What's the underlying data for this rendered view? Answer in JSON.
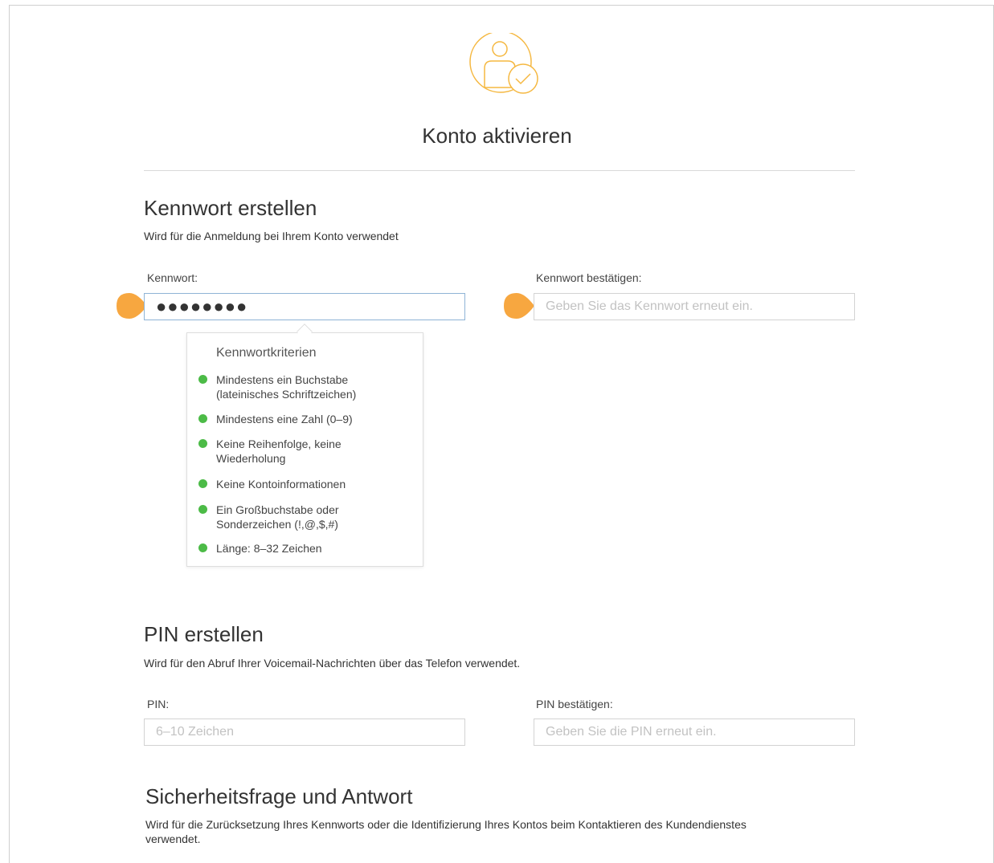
{
  "page": {
    "title": "Konto aktivieren"
  },
  "colors": {
    "accent": "#f7a740",
    "logo": "#f5b841",
    "success": "#4cbb47"
  },
  "icons": {
    "logo": "user-check-icon"
  },
  "password_section": {
    "title": "Kennwort erstellen",
    "description": "Wird für die Anmeldung bei Ihrem Konto verwendet",
    "password_label": "Kennwort:",
    "password_value": "●●●●●●●●",
    "confirm_label": "Kennwort bestätigen:",
    "confirm_placeholder": "Geben Sie das Kennwort erneut ein."
  },
  "criteria": {
    "title": "Kennwortkriterien",
    "items": [
      {
        "line1": "Mindestens ein Buchstabe",
        "line2": "(lateinisches Schriftzeichen)"
      },
      {
        "line1": "Mindestens eine Zahl (0–9)",
        "line2": ""
      },
      {
        "line1": "Keine Reihenfolge, keine",
        "line2": "Wiederholung"
      },
      {
        "line1": "Keine Kontoinformationen",
        "line2": ""
      },
      {
        "line1": "Ein Großbuchstabe oder",
        "line2": "Sonderzeichen (!,@,$,#)"
      },
      {
        "line1": "Länge: 8–32 Zeichen",
        "line2": ""
      }
    ]
  },
  "pin_section": {
    "title": "PIN erstellen",
    "description": "Wird für den Abruf Ihrer Voicemail-Nachrichten über das Telefon verwendet.",
    "pin_label": "PIN:",
    "pin_placeholder": "6–10 Zeichen",
    "confirm_label": "PIN bestätigen:",
    "confirm_placeholder": "Geben Sie die PIN erneut ein."
  },
  "security_section": {
    "title": "Sicherheitsfrage und Antwort",
    "description_line1": "Wird für die Zurücksetzung Ihres Kennworts oder die Identifizierung Ihres Kontos beim Kontaktieren des Kundendienstes",
    "description_line2": "verwendet."
  }
}
